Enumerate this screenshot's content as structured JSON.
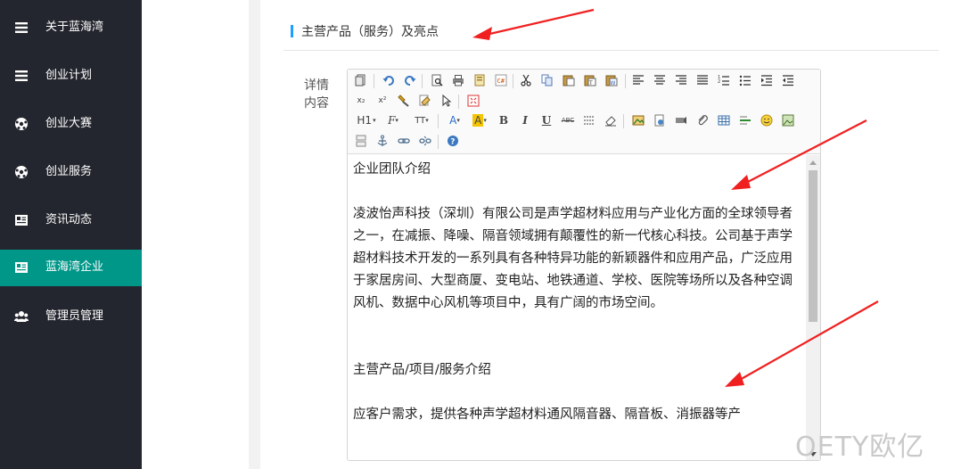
{
  "sidebar": {
    "items": [
      {
        "label": "关于蓝海湾",
        "icon": "menu-icon"
      },
      {
        "label": "创业计划",
        "icon": "menu-icon"
      },
      {
        "label": "创业大赛",
        "icon": "soccer-ball-icon"
      },
      {
        "label": "创业服务",
        "icon": "soccer-ball-icon"
      },
      {
        "label": "资讯动态",
        "icon": "newspaper-icon"
      },
      {
        "label": "蓝海湾企业",
        "icon": "newspaper-icon",
        "active": true
      },
      {
        "label": "管理员管理",
        "icon": "users-icon"
      }
    ],
    "active_color": "#009688",
    "bg_color": "#23262e"
  },
  "section": {
    "title": "主营产品（服务）及亮点",
    "accent_color": "#1E9FFF"
  },
  "field": {
    "label": "详情内容"
  },
  "toolbar": {
    "font_heading": "H1",
    "font_family_glyph": "F",
    "font_size_glyph": "TT",
    "text_color_glyph": "A",
    "bg_color_glyph": "A",
    "bold": "B",
    "italic": "I",
    "underline": "U",
    "strike": "ABC",
    "subscript": "x₂",
    "superscript": "x²"
  },
  "editor": {
    "paragraphs": [
      "企业团队介绍",
      "",
      "凌波怡声科技（深圳）有限公司是声学超材料应用与产业化方面的全球领导者之一，在减振、降噪、隔音领域拥有颠覆性的新一代核心科技。公司基于声学超材料技术开发的一系列具有各种特异功能的新颖器件和应用产品，广泛应用于家居房间、大型商厦、变电站、地铁通道、学校、医院等场所以及各种空调风机、数据中心风机等项目中，具有广阔的市场空间。",
      "",
      "",
      "主营产品/项目/服务介绍",
      "",
      "应客户需求，提供各种声学超材料通风隔音器、隔音板、消振器等产"
    ]
  },
  "annotations": {
    "arrow_color": "#f02020"
  },
  "watermark": {
    "text": "OETY欧亿"
  }
}
